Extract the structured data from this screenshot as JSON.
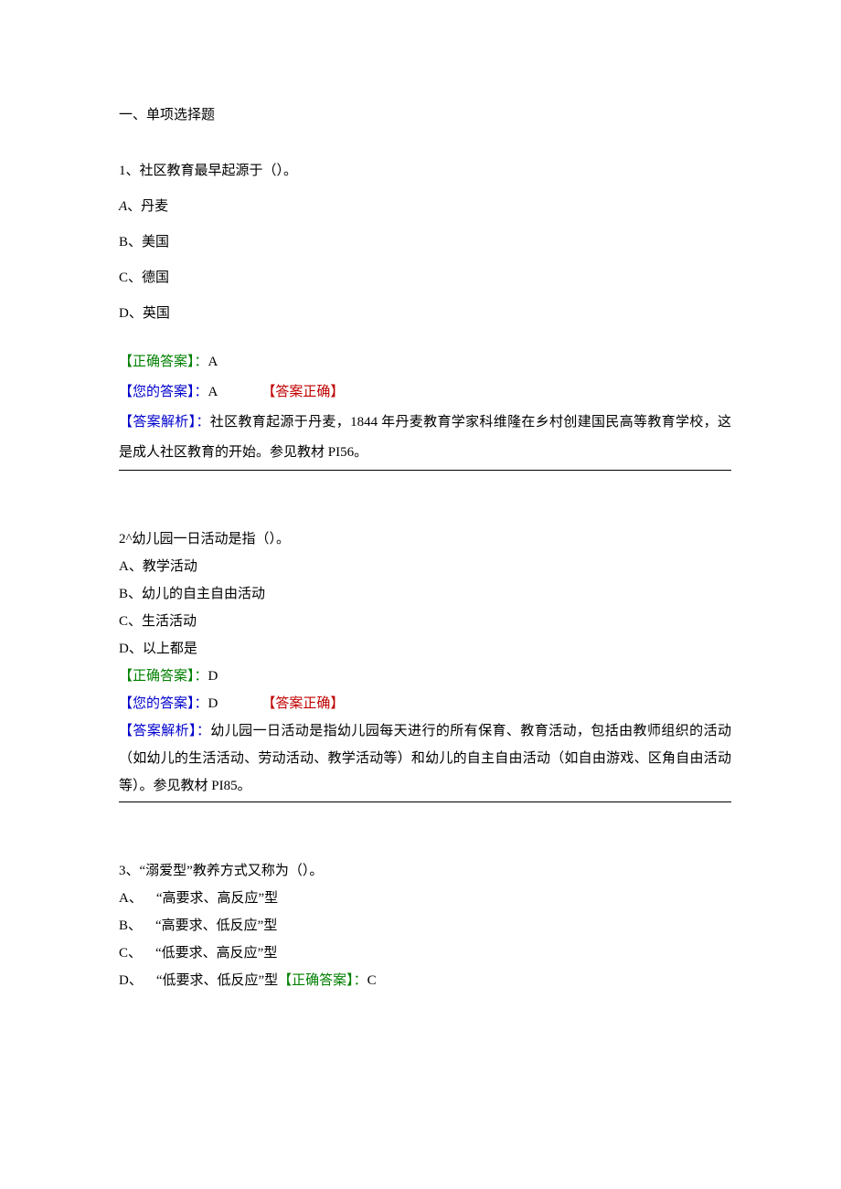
{
  "section_title": "一、单项选择题",
  "q1": {
    "stem": "1、社区教育最早起源于（）。",
    "optA_label": "A",
    "optA_text": "、丹麦",
    "optB": "B、美国",
    "optC": "C、德国",
    "optD": "D、英国",
    "correct_label": "【正确答案】：",
    "correct_value": "A",
    "your_label": "【您的答案】：",
    "your_value": "A",
    "result": "【答案正确】",
    "analysis_label": "【答案解析】：",
    "analysis_text": "社区教育起源于丹麦，1844 年丹麦教育学家科维隆在乡村创建国民高等教育学校，这是成人社区教育的开始。参见教材 PI56。"
  },
  "q2": {
    "stem": "2^幼儿园一日活动是指（）。",
    "optA": "A、教学活动",
    "optB": "B、幼儿的自主自由活动",
    "optC": "C、生活活动",
    "optD": "D、以上都是",
    "correct_label": "【正确答案】：",
    "correct_value": "D",
    "your_label": "【您的答案】：",
    "your_value": "D",
    "result": "【答案正确】",
    "analysis_label": "【答案解析】：",
    "analysis_text": "幼儿园一日活动是指幼儿园每天进行的所有保育、教育活动，包括由教师组织的活动（如幼儿的生活活动、劳动活动、教学活动等）和幼儿的自主自由活动（如自由游戏、区角自由活动等）。参见教材 PI85。"
  },
  "q3": {
    "stem": "3、“溺爱型”教养方式又称为（）。",
    "optA": "A、 “高要求、高反应”型",
    "optB": "B、 “高要求、低反应”型",
    "optC": "C、 “低要求、高反应”型",
    "optD_prefix": "D、 “低要求、低反应”型",
    "correct_label": "【正确答案】：",
    "correct_value": "C"
  }
}
